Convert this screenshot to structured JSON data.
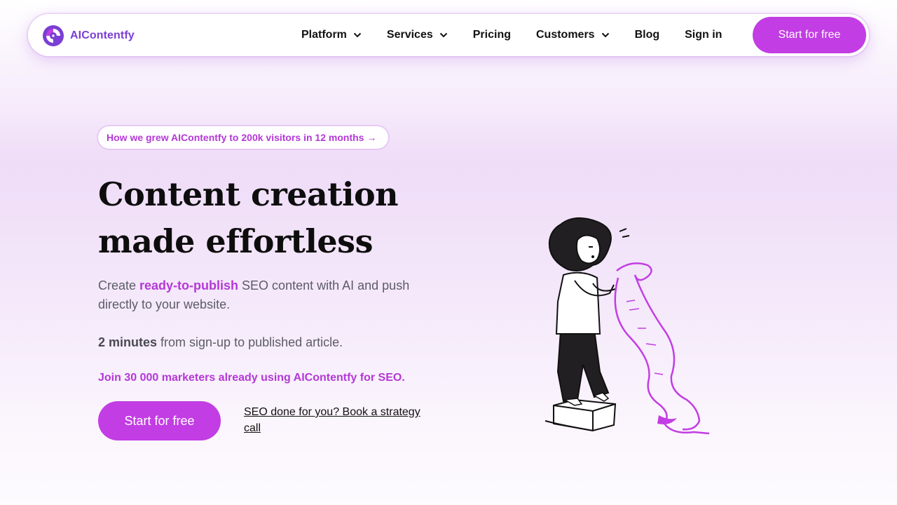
{
  "header": {
    "brand": "AIContentfy",
    "nav": [
      {
        "label": "Platform",
        "has_dropdown": true
      },
      {
        "label": "Services",
        "has_dropdown": true
      },
      {
        "label": "Pricing",
        "has_dropdown": false
      },
      {
        "label": "Customers",
        "has_dropdown": true
      },
      {
        "label": "Blog",
        "has_dropdown": false
      },
      {
        "label": "Sign in",
        "has_dropdown": false
      }
    ],
    "cta_label": "Start for free"
  },
  "hero": {
    "announcement": "How we grew AIContentfy to 200k visitors in 12 months →",
    "headline": "Content creation made effortless",
    "lead_prefix": "Create ",
    "lead_highlight": "ready-to-publish",
    "lead_suffix": " SEO content with AI and push directly to your website.",
    "speed_bold": "2 minutes",
    "speed_rest": " from sign-up to published article.",
    "social_proof": "Join 30 000 marketers already using AIContentfy for SEO.",
    "cta_label": "Start for free",
    "secondary_link": "SEO done for you? Book a strategy call"
  },
  "colors": {
    "accent": "#c23de3",
    "accent_text": "#b438d6",
    "logo_purple": "#7a3fd4"
  },
  "icons": [
    "aicontentfy-logo-icon",
    "chevron-down-icon",
    "woman-reading-scroll-illustration"
  ]
}
